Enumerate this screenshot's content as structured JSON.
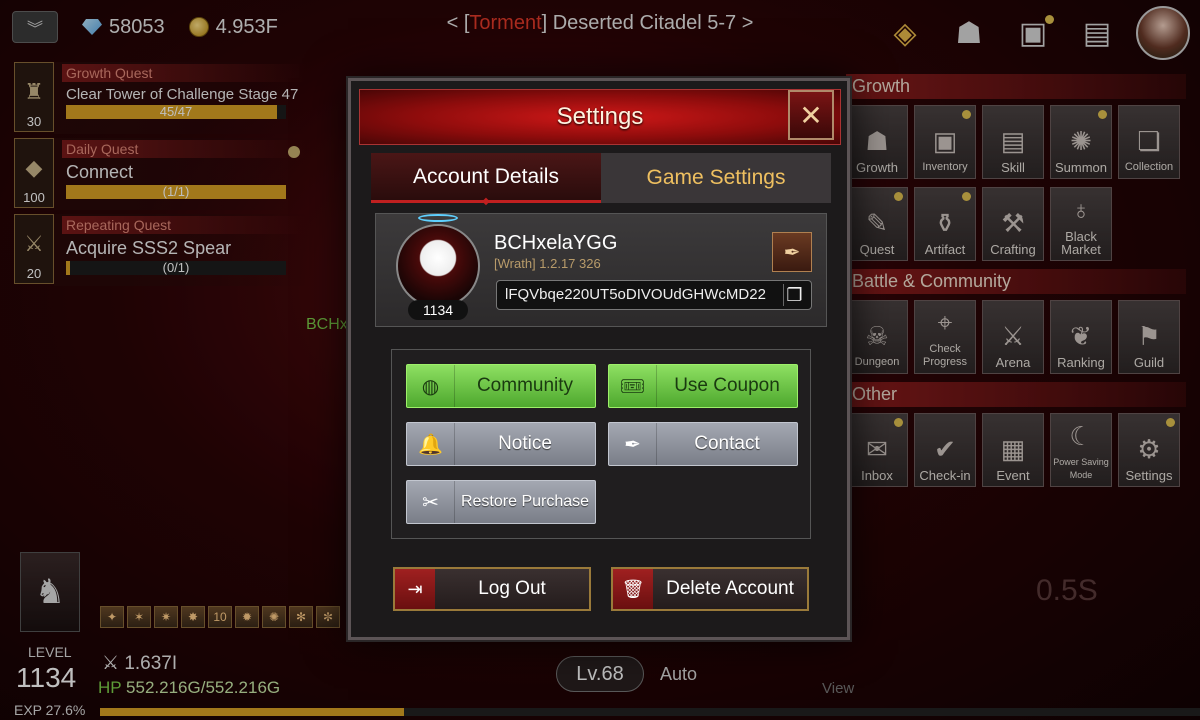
{
  "hud": {
    "gems": "58053",
    "gold": "4.953F",
    "stage_prefix": "< [",
    "stage_mode": "Torment",
    "stage_suffix": "] Deserted Citadel 5-7 >",
    "level_label": "LEVEL",
    "level_value": "1134",
    "exp_text": "EXP 27.6%",
    "exp_fraction": 0.276,
    "power": "1.637I",
    "hp_label": "HP",
    "hp_value": "552.216G/552.216G",
    "lv_pill": "Lv.68",
    "auto_label": "Auto",
    "view_label": "View",
    "timer": "0.5S",
    "name_tag": "BCHx",
    "skill_chip_count": "10"
  },
  "quests": [
    {
      "type": "Growth Quest",
      "desc": "Clear Tower of Challenge Stage 47",
      "progress": "45/47",
      "fraction": 0.957,
      "level": "30",
      "icon": "tower-icon"
    },
    {
      "type": "Daily Quest",
      "desc": "Connect",
      "progress": "(1/1)",
      "fraction": 1.0,
      "level": "100",
      "icon": "diamond-icon"
    },
    {
      "type": "Repeating Quest",
      "desc": "Acquire SSS2 Spear",
      "progress": "(0/1)",
      "fraction": 0.02,
      "level": "20",
      "icon": "spear-icon"
    }
  ],
  "side_menu": {
    "growth_title": "Growth",
    "growth_items": [
      "Growth",
      "Inventory",
      "Skill",
      "Summon",
      "Collection",
      "Quest",
      "Artifact",
      "Crafting",
      "Black Market"
    ],
    "battle_title": "Battle & Community",
    "battle_items": [
      "Dungeon",
      "Check Progress",
      "Arena",
      "Ranking",
      "Guild"
    ],
    "other_title": "Other",
    "other_items": [
      "Inbox",
      "Check-in",
      "Event",
      "Power Saving Mode",
      "Settings"
    ]
  },
  "dialog": {
    "title": "Settings",
    "tabs": [
      "Account Details",
      "Game Settings"
    ],
    "account": {
      "name": "BCHxelaYGG",
      "meta": "[Wrath] 1.2.17 326",
      "level": "1134",
      "id": "lFQVbqe220UT5oDIVOUdGHWcMD22"
    },
    "buttons": {
      "community": "Community",
      "coupon": "Use Coupon",
      "notice": "Notice",
      "contact": "Contact",
      "restore": "Restore Purchase",
      "logout": "Log Out",
      "delete": "Delete Account"
    }
  },
  "colors": {
    "accent_red": "#c02020",
    "button_green": "#6cc445",
    "gold": "#d8a024"
  }
}
